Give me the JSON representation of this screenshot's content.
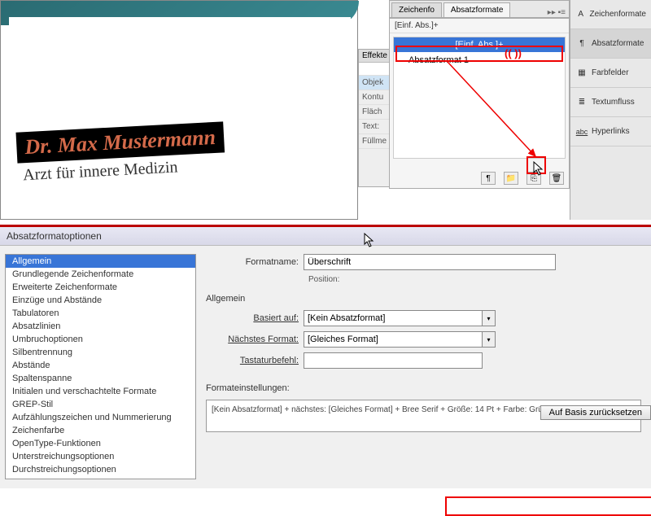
{
  "document": {
    "headline": "Dr. Max Mustermann",
    "subline": "Arzt für innere Medizin"
  },
  "fx": {
    "tab": "Effekte",
    "obj": "Objek",
    "rows": [
      "Kontu",
      "Fläch",
      "Text:",
      "Füllme"
    ]
  },
  "panel": {
    "tab_zeich": "Zeichenfo",
    "tab_absatz": "Absatzformate",
    "header": "[Einf. Abs.]+",
    "styles": {
      "basic": "[Einf. Abs.]+",
      "new": "Absatzformat 1"
    },
    "annotation_parens": "((   ))"
  },
  "right_items": [
    {
      "icon": "A",
      "label": "Zeichenformate"
    },
    {
      "icon": "¶",
      "label": "Absatzformate"
    },
    {
      "icon": "▦",
      "label": "Farbfelder"
    },
    {
      "icon": "≣",
      "label": "Textumfluss"
    },
    {
      "icon": "abc",
      "label": "Hyperlinks"
    }
  ],
  "dialog": {
    "title": "Absatzformatoptionen",
    "sidebar": [
      "Allgemein",
      "Grundlegende Zeichenformate",
      "Erweiterte Zeichenformate",
      "Einzüge und Abstände",
      "Tabulatoren",
      "Absatzlinien",
      "Umbruchoptionen",
      "Silbentrennung",
      "Abstände",
      "Spaltenspanne",
      "Initialen und verschachtelte Formate",
      "GREP-Stil",
      "Aufzählungszeichen und Nummerierung",
      "Zeichenfarbe",
      "OpenType-Funktionen",
      "Unterstreichungsoptionen",
      "Durchstreichungsoptionen"
    ],
    "labels": {
      "formatname": "Formatname:",
      "position": "Position:",
      "allgemein": "Allgemein",
      "basiert": "Basiert auf:",
      "naechstes": "Nächstes Format:",
      "tastatur": "Tastaturbefehl:",
      "einstellungen": "Formateinstellungen:",
      "reset": "Auf Basis zurücksetzen"
    },
    "values": {
      "formatname": "Überschrift",
      "basiert": "[Kein Absatzformat]",
      "naechstes": "[Gleiches Format]",
      "tastatur": "",
      "settings_text": "[Kein Absatzformat] + nächstes: [Gleiches Format] + Bree Serif + Größe: 14 Pt + Farbe: Grün"
    }
  }
}
